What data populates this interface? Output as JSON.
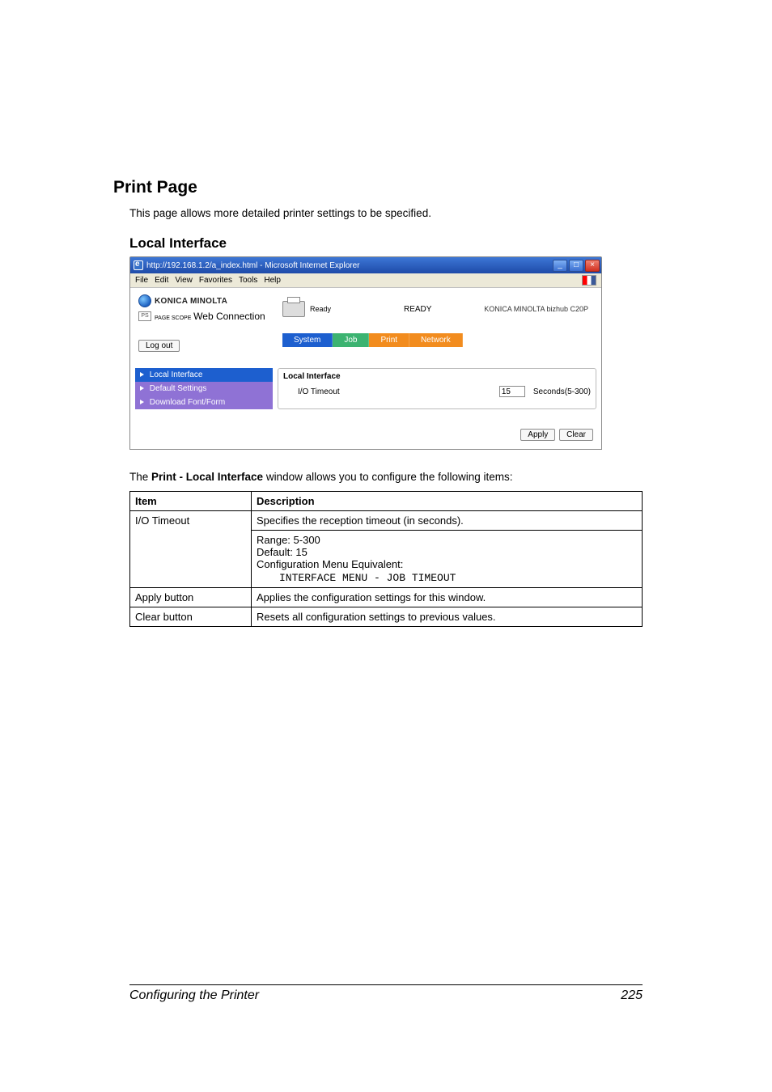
{
  "headings": {
    "h1": "Print Page",
    "h1_para": "This page allows more detailed printer settings to be specified.",
    "h2": "Local Interface"
  },
  "window": {
    "title": "http://192.168.1.2/a_index.html - Microsoft Internet Explorer",
    "menu": {
      "file": "File",
      "edit": "Edit",
      "view": "View",
      "favorites": "Favorites",
      "tools": "Tools",
      "help": "Help"
    },
    "minimize": "_",
    "maximize": "□",
    "close": "×"
  },
  "app": {
    "brand": "KONICA MINOLTA",
    "subbrand_small": "PAGE SCOPE",
    "subbrand_big": "Web Connection",
    "printer_status": "Ready",
    "ready_heading": "READY",
    "model": "KONICA MINOLTA bizhub C20P",
    "logout": "Log out",
    "tabs": {
      "system": "System",
      "job": "Job",
      "print": "Print",
      "network": "Network"
    },
    "sidebar": {
      "local": "Local Interface",
      "default": "Default Settings",
      "download": "Download Font/Form"
    },
    "mainpane": {
      "title": "Local Interface",
      "row_label": "I/O Timeout",
      "row_value": "15",
      "row_unit": "Seconds(5-300)"
    },
    "buttons": {
      "apply": "Apply",
      "clear": "Clear"
    }
  },
  "before_table_1": "The ",
  "before_table_bold": "Print - Local Interface",
  "before_table_2": " window allows you to configure the following items:",
  "table": {
    "headers": {
      "c1": "Item",
      "c2": "Description"
    },
    "rows": [
      {
        "c1": "I/O Timeout",
        "c2_line1": "Specifies the reception timeout (in seconds).",
        "c2_line2": "Range:   5-300",
        "c2_line3": "Default:  15",
        "c2_line4": "Configuration Menu Equivalent:",
        "c2_mono": "INTERFACE MENU - JOB TIMEOUT"
      },
      {
        "c1": "Apply button",
        "c2": "Applies the configuration settings for this window."
      },
      {
        "c1": "Clear button",
        "c2": "Resets all configuration settings to previous values."
      }
    ]
  },
  "footer": {
    "left": "Configuring the Printer",
    "right": "225"
  }
}
